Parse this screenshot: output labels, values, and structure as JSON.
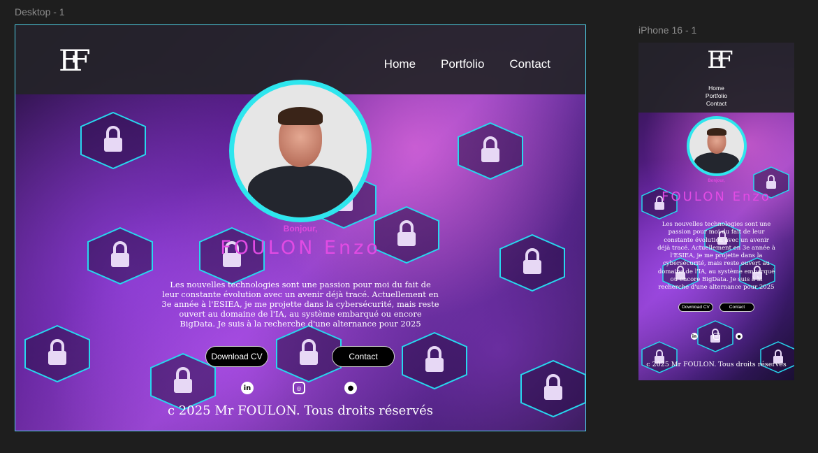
{
  "canvas": {
    "desktop_frame_label": "Desktop - 1",
    "phone_frame_label": "iPhone 16 - 1"
  },
  "site": {
    "logo": "EF",
    "nav": [
      "Home",
      "Portfolio",
      "Contact"
    ],
    "greeting": "Bonjour,",
    "name": "FOULON Enzo",
    "bio": "Les nouvelles technologies sont une passion pour moi  du fait de leur constante évolution avec un avenir déjà tracé.  Actuellement en 3e année à l'ESIEA, je me projette dans la  cybersécurité, mais reste ouvert au domaine de l'IA, au système embarqué ou encore BigData. Je suis à la recherche d'une alternance pour 2025",
    "buttons": {
      "download_cv": "Download CV",
      "contact": "Contact"
    },
    "social_icons": [
      "linkedin-icon",
      "instagram-icon",
      "github-icon"
    ],
    "footer": "c 2025 Mr FOULON. Tous droits réservés"
  },
  "colors": {
    "accent_cyan": "#2ee6ee",
    "accent_magenta": "#e24be4",
    "header_bg": "#232328",
    "canvas_bg": "#1e1e1e"
  }
}
